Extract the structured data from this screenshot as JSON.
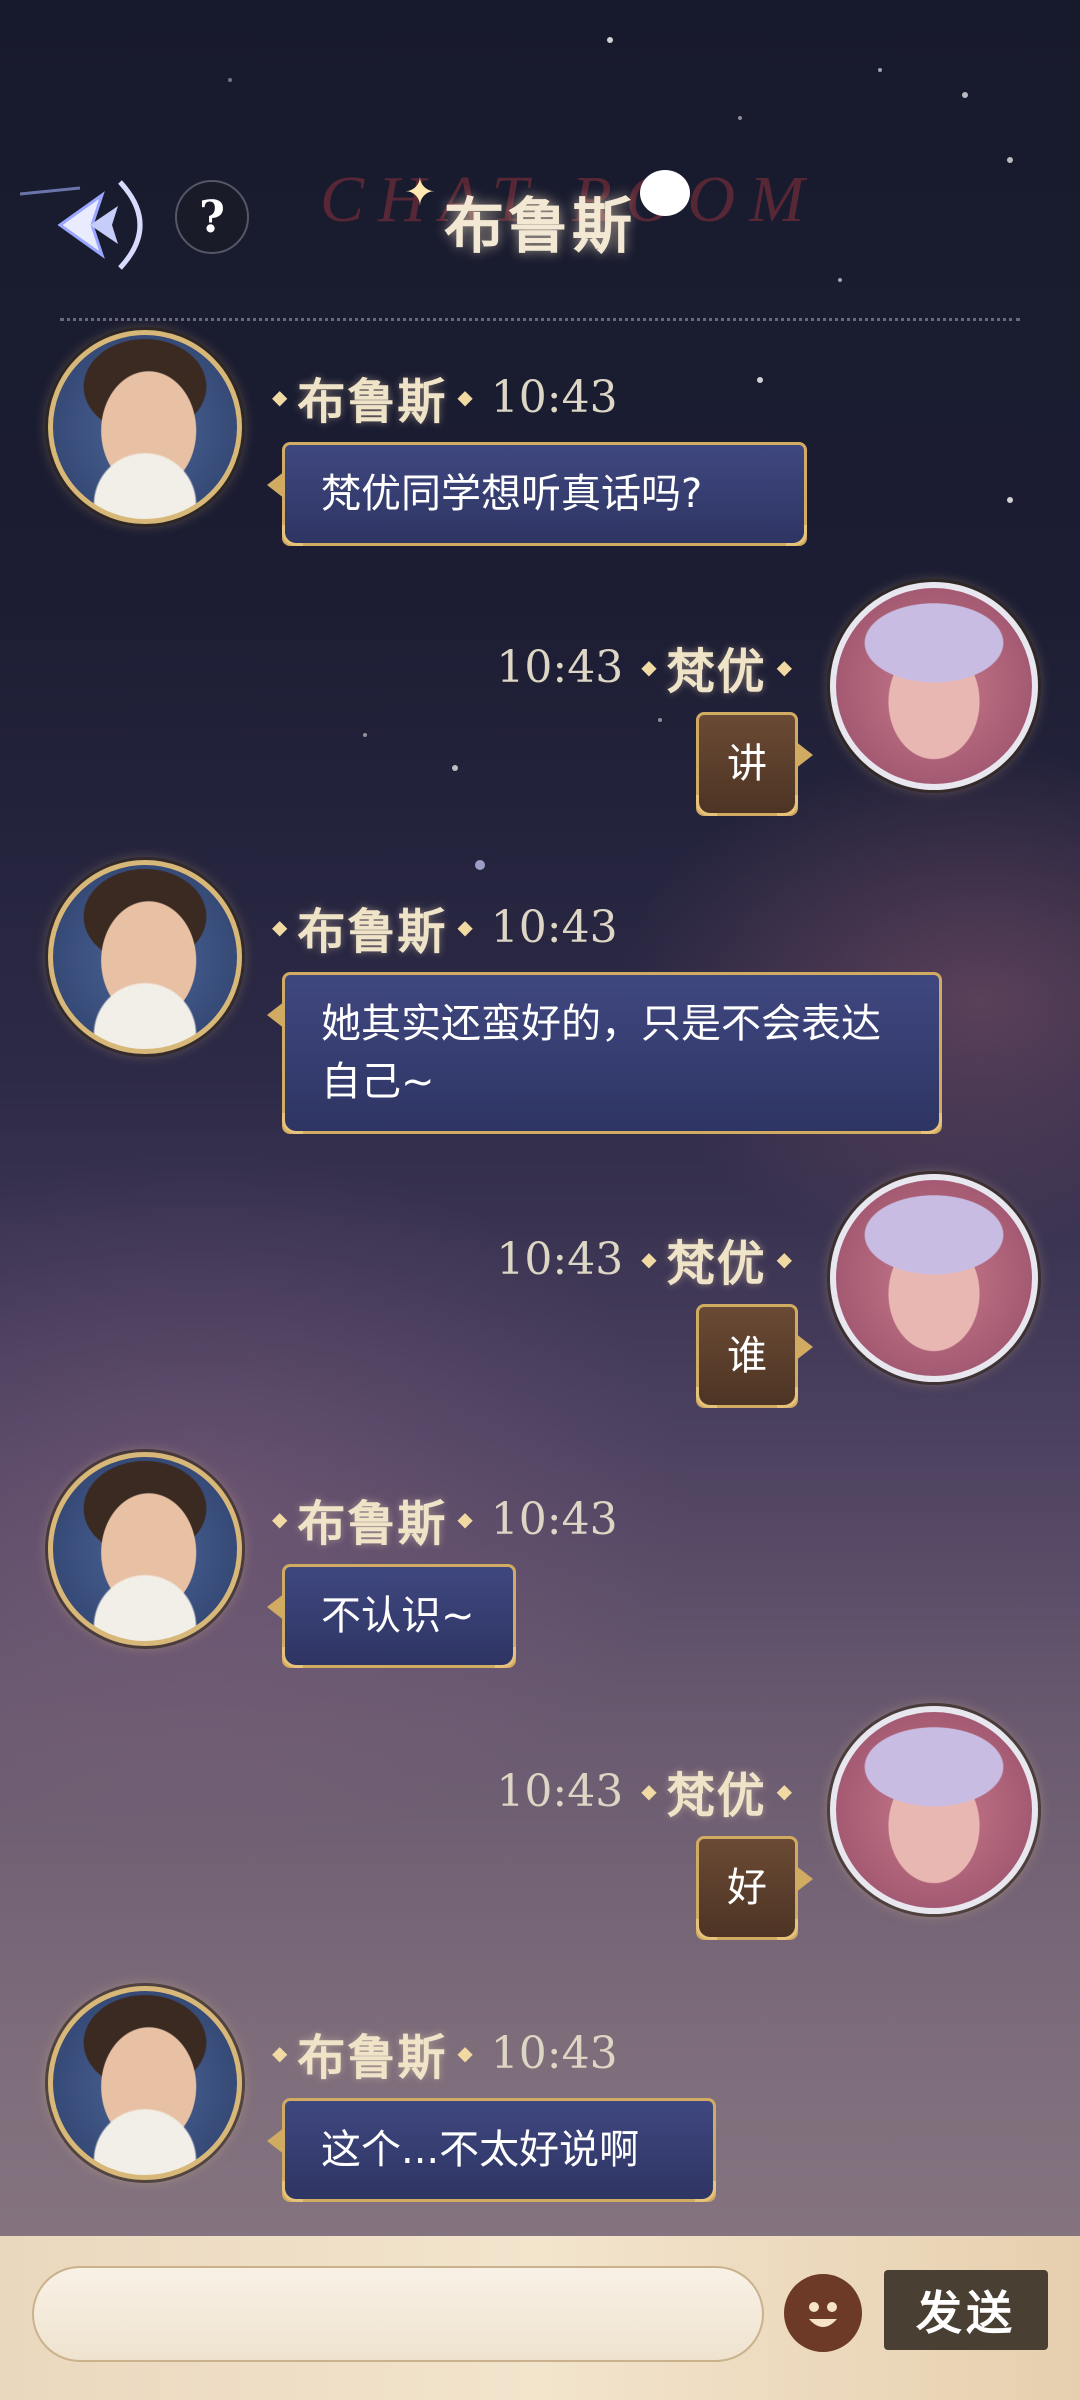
{
  "header": {
    "title": "布鲁斯",
    "help_label": "?",
    "background_text": "CHAT ROOM",
    "icons": [
      "back-arrow-icon",
      "help-icon",
      "sparkle-icon",
      "chat-bubble-icon"
    ]
  },
  "messages": [
    {
      "sender": "布鲁斯",
      "time": "10:43",
      "text": "梵优同学想听真话吗?",
      "side": "left"
    },
    {
      "sender": "梵优",
      "time": "10:43",
      "text": "讲",
      "side": "right"
    },
    {
      "sender": "布鲁斯",
      "time": "10:43",
      "text": "她其实还蛮好的，只是不会表达自己~",
      "side": "left"
    },
    {
      "sender": "梵优",
      "time": "10:43",
      "text": "谁",
      "side": "right"
    },
    {
      "sender": "布鲁斯",
      "time": "10:43",
      "text": "不认识~",
      "side": "left"
    },
    {
      "sender": "梵优",
      "time": "10:43",
      "text": "好",
      "side": "right"
    },
    {
      "sender": "布鲁斯",
      "time": "10:43",
      "text": "这个...不太好说啊",
      "side": "left"
    }
  ],
  "composer": {
    "input_value": "",
    "input_placeholder": "",
    "send_label": "发送",
    "emoji_icon": "smiley-face-icon"
  },
  "colors": {
    "left_bubble": "#3f4780",
    "right_bubble": "#6a4a34",
    "bubble_border": "#d2ab62",
    "name_text": "#efe3c8",
    "input_bar": "#ead8be",
    "send_button": "#4a3f33"
  }
}
